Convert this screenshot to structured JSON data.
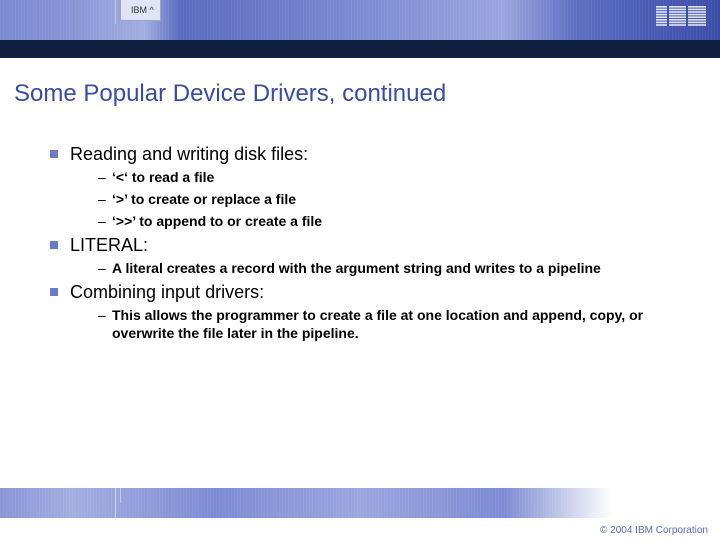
{
  "header": {
    "tab_label": "IBM ^"
  },
  "title": "Some Popular Device Drivers, continued",
  "sections": [
    {
      "heading": "Reading and writing disk files:",
      "items": [
        "‘<‘ to read a file",
        "‘>’ to create or replace a file",
        "‘>>’ to append to or create a file"
      ]
    },
    {
      "heading": "LITERAL:",
      "items": [
        "A literal creates a record with the argument string and writes to a pipeline"
      ]
    },
    {
      "heading": "Combining input drivers:",
      "items": [
        "This allows the programmer to create a file at one location and append, copy, or overwrite the file later in the pipeline."
      ]
    }
  ],
  "footer": {
    "copyright": "© 2004 IBM Corporation"
  }
}
